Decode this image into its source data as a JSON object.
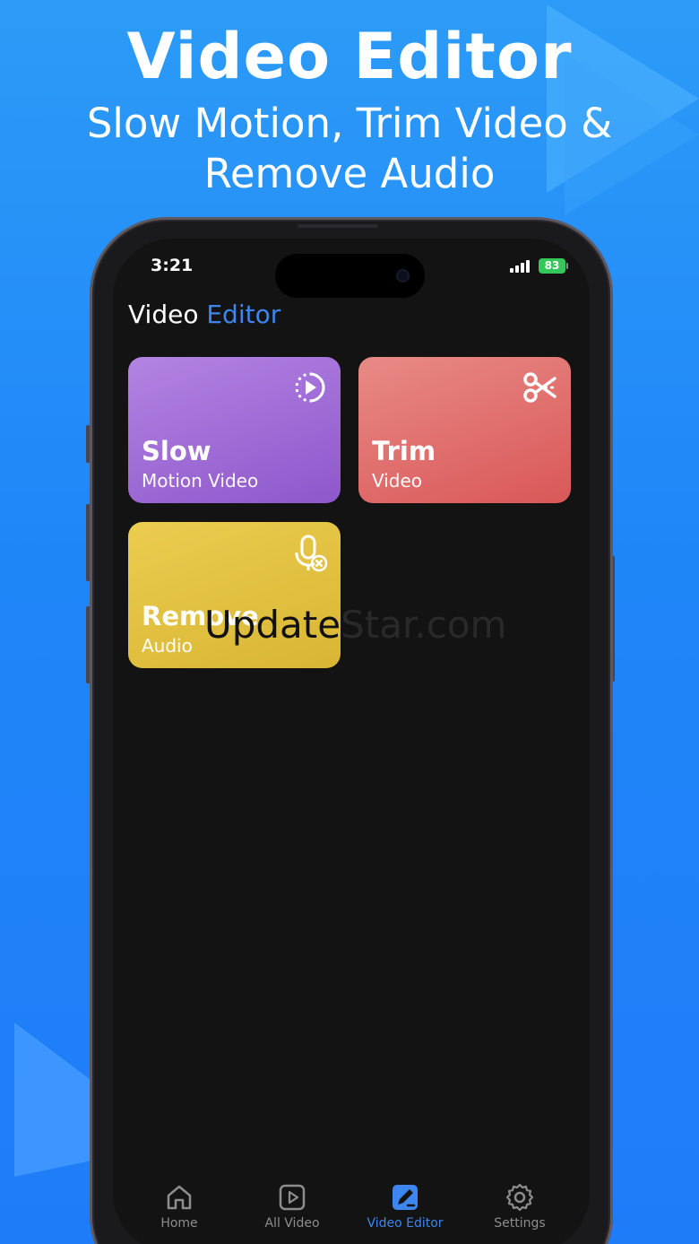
{
  "promo": {
    "title": "Video Editor",
    "subtitle_line1": "Slow Motion, Trim Video &",
    "subtitle_line2": "Remove Audio"
  },
  "status_bar": {
    "time": "3:21",
    "battery": "83"
  },
  "header": {
    "title_part1": "Video",
    "title_part2": "Editor"
  },
  "cards": [
    {
      "title": "Slow",
      "subtitle": "Motion Video",
      "icon": "slow-motion-play-icon",
      "color": "#a06fd7"
    },
    {
      "title": "Trim",
      "subtitle": "Video",
      "icon": "scissors-icon",
      "color": "#e06a68"
    },
    {
      "title": "Remove",
      "subtitle": "Audio",
      "icon": "mute-microphone-icon",
      "color": "#e3c23f"
    }
  ],
  "watermark": {
    "part1": "Update",
    "part2": "Star.com"
  },
  "tabs": [
    {
      "label": "Home",
      "icon": "home-icon",
      "active": false
    },
    {
      "label": "All Video",
      "icon": "play-square-icon",
      "active": false
    },
    {
      "label": "Video Editor",
      "icon": "edit-icon",
      "active": true
    },
    {
      "label": "Settings",
      "icon": "gear-icon",
      "active": false
    }
  ],
  "colors": {
    "accent": "#3d86ef",
    "background_top": "#2c9bf7",
    "background_bottom": "#1f7cf8",
    "screen": "#131313",
    "battery": "#34c759"
  }
}
